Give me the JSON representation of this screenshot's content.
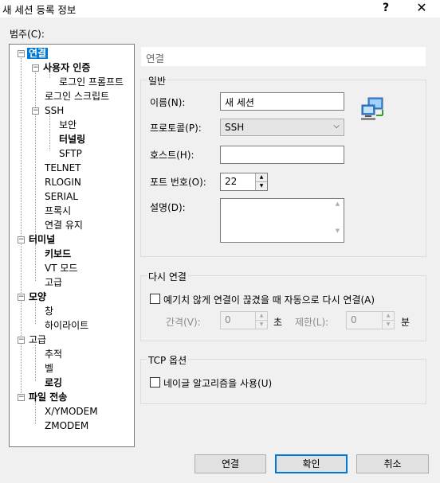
{
  "window": {
    "title": "새 세션 등록 정보",
    "help": "?",
    "close": "✕"
  },
  "category_label": "범주(C):",
  "tree": {
    "connection": "연결",
    "user_auth": "사용자 인증",
    "login_prompt": "로그인 프롬프트",
    "login_script": "로그인 스크립트",
    "ssh": "SSH",
    "security": "보안",
    "tunneling": "터널링",
    "sftp": "SFTP",
    "telnet": "TELNET",
    "rlogin": "RLOGIN",
    "serial": "SERIAL",
    "proxy": "프록시",
    "keepalive": "연결 유지",
    "terminal": "터미널",
    "keyboard": "키보드",
    "vt_mode": "VT 모드",
    "advanced": "고급",
    "appearance": "모양",
    "window": "창",
    "highlight": "하이라이트",
    "advanced2": "고급",
    "trace": "추적",
    "bell": "벨",
    "logging": "로깅",
    "file_transfer": "파일 전송",
    "xymodem": "X/YMODEM",
    "zmodem": "ZMODEM"
  },
  "panel_header": "연결",
  "general": {
    "title": "일반",
    "name_label": "이름(N):",
    "name_value": "새 세션",
    "protocol_label": "프로토콜(P):",
    "protocol_value": "SSH",
    "host_label": "호스트(H):",
    "host_value": "",
    "port_label": "포트 번호(O):",
    "port_value": "22",
    "desc_label": "설명(D):",
    "desc_value": ""
  },
  "reconnect": {
    "title": "다시 연결",
    "auto_label": "예기치 않게 연결이 끊겼을 때 자동으로 다시 연결(A)",
    "interval_label": "간격(V):",
    "interval_value": "0",
    "interval_unit": "초",
    "limit_label": "제한(L):",
    "limit_value": "0",
    "limit_unit": "분"
  },
  "tcp": {
    "title": "TCP 옵션",
    "nagle_label": "네이글 알고리즘을 사용(U)"
  },
  "buttons": {
    "connect": "연결",
    "ok": "확인",
    "cancel": "취소"
  },
  "colors": {
    "selection": "#0078d7",
    "default_button_border": "#0078d7"
  }
}
